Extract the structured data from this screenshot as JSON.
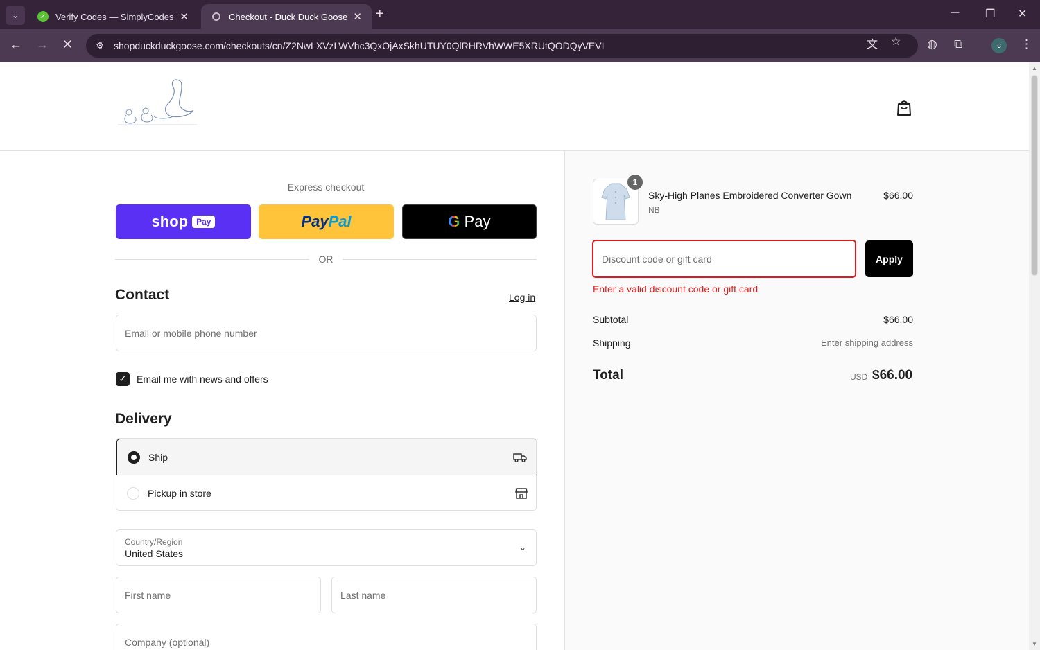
{
  "browser": {
    "tabs": [
      {
        "title": "Verify Codes — SimplyCodes",
        "close": "✕"
      },
      {
        "title": "Checkout - Duck Duck Goose",
        "close": "✕"
      }
    ],
    "new_tab": "+",
    "url": "shopduckduckgoose.com/checkouts/cn/Z2NwLXVzLWVhc3QxOjAxSkhUTUY0QlRHRVhWWE5XRUtQODQyVEVI",
    "avatar_letter": "c",
    "window_controls": {
      "minimize": "─",
      "restore": "❐",
      "close": "✕"
    }
  },
  "header": {
    "logo_text": "Duck Duck Goose",
    "logo_subtext": "A CHILDREN'S SHOP"
  },
  "express": {
    "label": "Express checkout",
    "shop_pay": {
      "word": "shop",
      "badge": "Pay"
    },
    "paypal": {
      "part1": "Pay",
      "part2": "Pal"
    },
    "gpay": {
      "g": "G",
      "word": "Pay"
    },
    "or_label": "OR"
  },
  "contact": {
    "heading": "Contact",
    "login_label": "Log in",
    "email_placeholder": "Email or mobile phone number",
    "newsletter_label": "Email me with news and offers",
    "newsletter_checked": true
  },
  "delivery": {
    "heading": "Delivery",
    "options": [
      {
        "label": "Ship",
        "selected": true,
        "icon": "truck-icon"
      },
      {
        "label": "Pickup in store",
        "selected": false,
        "icon": "store-icon"
      }
    ],
    "country_label": "Country/Region",
    "country_value": "United States",
    "first_name_placeholder": "First name",
    "last_name_placeholder": "Last name",
    "company_placeholder": "Company (optional)"
  },
  "order": {
    "item": {
      "quantity": "1",
      "name": "Sky-High Planes Embroidered Converter Gown",
      "variant": "NB",
      "price": "$66.00"
    },
    "discount_placeholder": "Discount code or gift card",
    "apply_label": "Apply",
    "discount_error": "Enter a valid discount code or gift card",
    "subtotal_label": "Subtotal",
    "subtotal_value": "$66.00",
    "shipping_label": "Shipping",
    "shipping_value": "Enter shipping address",
    "total_label": "Total",
    "total_currency": "USD",
    "total_value": "$66.00"
  },
  "colors": {
    "shop_pay": "#5a31f4",
    "paypal_bg": "#ffc439",
    "error": "#dd1d1d",
    "chrome_bg": "#35233a"
  }
}
